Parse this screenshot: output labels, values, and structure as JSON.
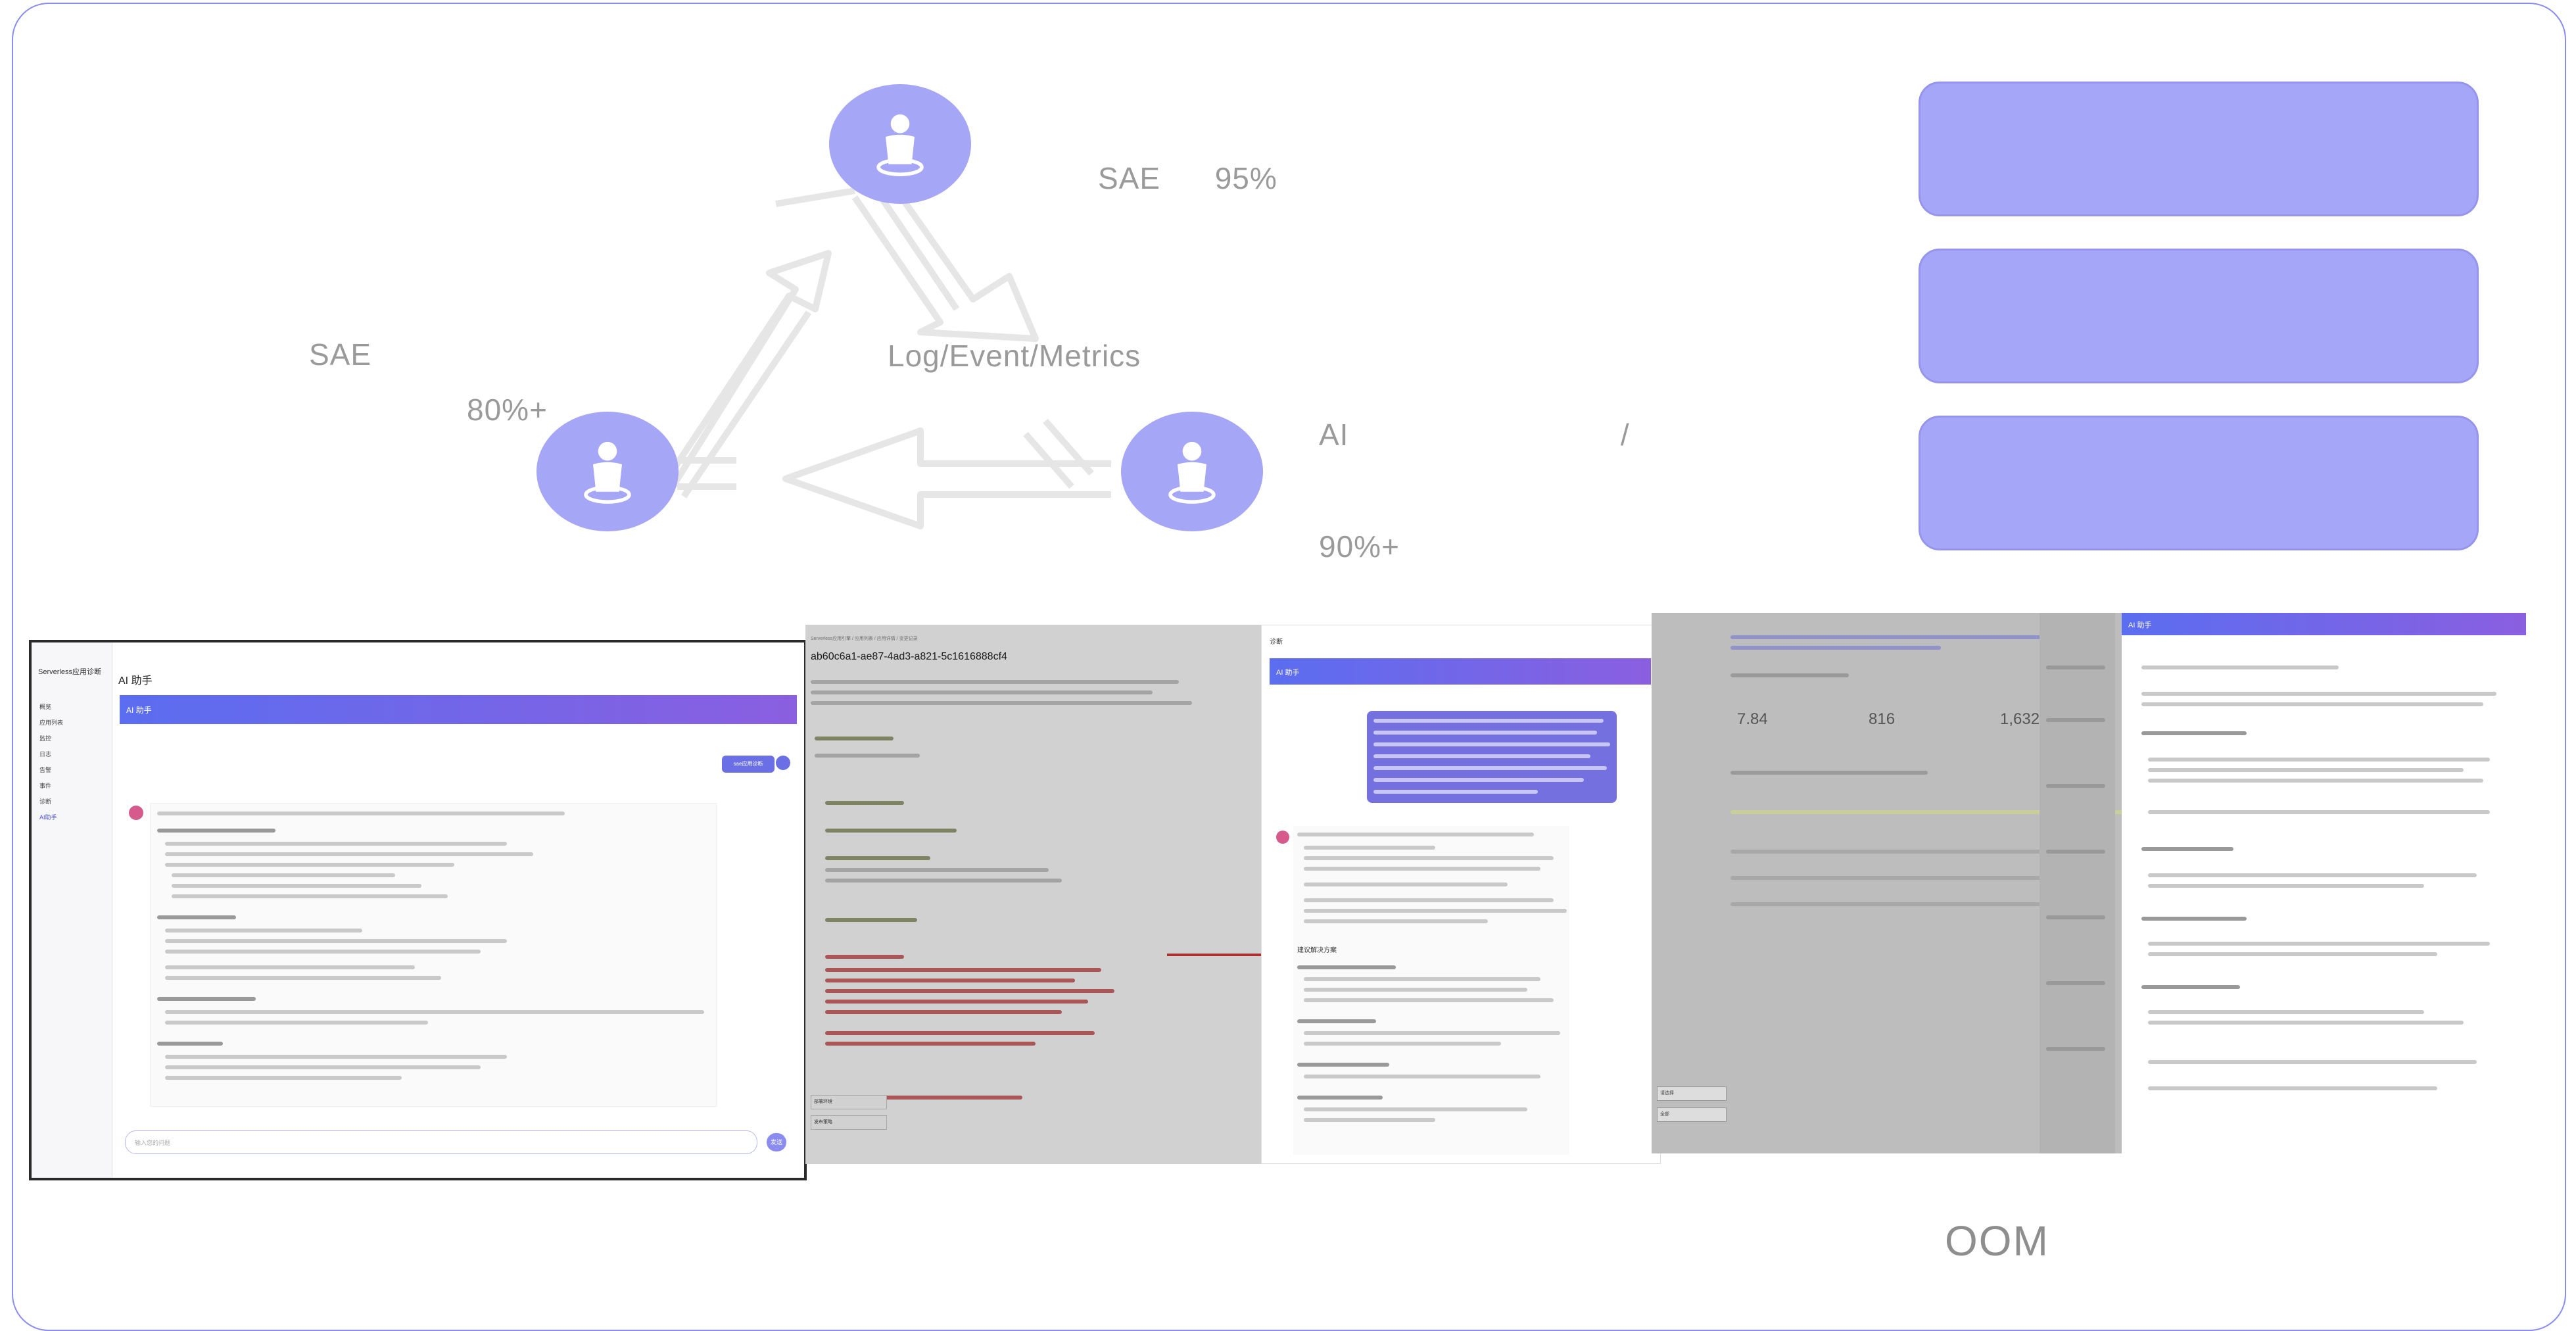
{
  "diagram": {
    "top_label": "SAE      95%",
    "left_label": "SAE",
    "left_percent": "80%+",
    "center_label": "Log/Event/Metrics",
    "right_label": "AI                              /",
    "right_percent": "90%+",
    "nodes": [
      "person-icon",
      "person-icon",
      "person-icon"
    ],
    "accent_color": "#a5a6f6"
  },
  "cards": [
    {
      "label": ""
    },
    {
      "label": ""
    },
    {
      "label": ""
    }
  ],
  "screenshot1": {
    "app_title": "Serverless应用诊断",
    "page_title": "AI 助手",
    "panel_title": "AI 助手",
    "nav_items": [
      "概览",
      "应用列表",
      "监控",
      "日志",
      "告警",
      "事件",
      "诊断",
      "AI助手"
    ],
    "user_message": "sae应用诊断",
    "input_placeholder": "输入您的问题",
    "send_label": "发送"
  },
  "screenshot2": {
    "breadcrumb": "Serverless应用引擎 / 应用列表 / 应用详情 / 变更记录",
    "trace_id": "ab60c6a1-ae87-4ad3-a821-5c1616888cf4",
    "footer_select_1": "部署环境",
    "footer_select_2": "发布策略"
  },
  "screenshot3": {
    "window_title": "诊断",
    "panel_title": "AI 助手",
    "section_title": "建议解决方案"
  },
  "screenshot4": {
    "metrics": [
      "7.84",
      "816",
      "1,632"
    ],
    "panel_title": "AI 助手",
    "footer_select_1": "请选择",
    "footer_select_2": "全部"
  },
  "bottom_label": "OOM"
}
